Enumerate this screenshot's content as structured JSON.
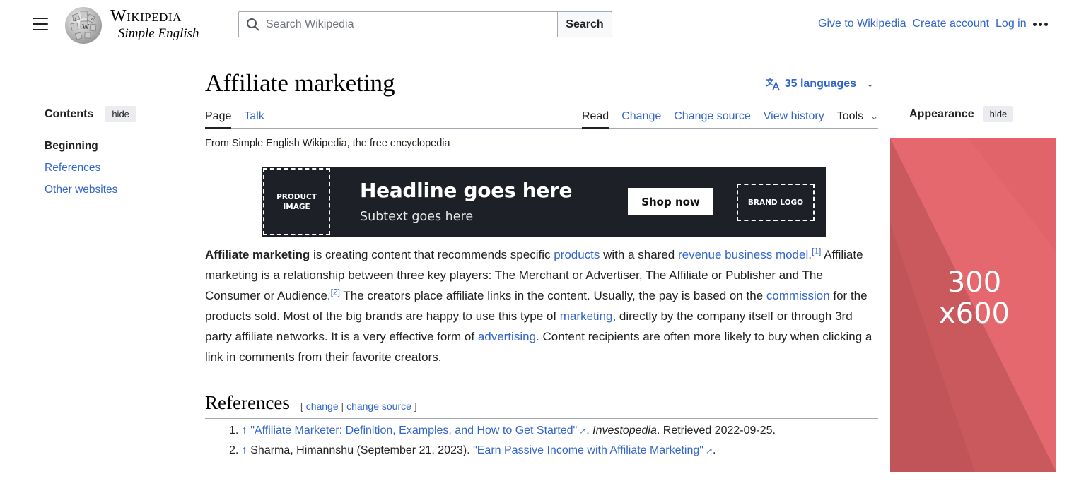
{
  "header": {
    "wordmark": "Wikipedia",
    "tagline": "Simple English",
    "search_placeholder": "Search Wikipedia",
    "search_button": "Search",
    "user_links": [
      "Give to Wikipedia",
      "Create account",
      "Log in"
    ]
  },
  "toc": {
    "title": "Contents",
    "hide": "hide",
    "items": [
      "Beginning",
      "References",
      "Other websites"
    ]
  },
  "article": {
    "title": "Affiliate marketing",
    "languages": "35 languages",
    "tabs_left": [
      "Page",
      "Talk"
    ],
    "tabs_right": [
      "Read",
      "Change",
      "Change source",
      "View history"
    ],
    "tools": "Tools",
    "from": "From Simple English Wikipedia, the free encyclopedia"
  },
  "banner": {
    "product_image": "PRODUCT IMAGE",
    "headline": "Headline goes here",
    "subtext": "Subtext goes here",
    "shop": "Shop now",
    "brand_logo": "BRAND LOGO"
  },
  "body": {
    "lead_bold": "Affiliate marketing",
    "t1": " is creating content that recommends specific ",
    "l1": "products",
    "t2": " with a shared ",
    "l2": "revenue business model",
    "t3": ".",
    "r1": "[1]",
    "t4": " Affiliate marketing is a relationship between three key players: The Merchant or Advertiser, The Affiliate or Publisher and The Consumer or Audience.",
    "r2": "[2]",
    "t5": " The creators place affiliate links in the content. Usually, the pay is based on the ",
    "l3": "commission",
    "t6": " for the products sold. Most of the big brands are happy to use this type of ",
    "l4": "marketing",
    "t7": ", directly by the company itself or through 3rd party affiliate networks. It is a very effective form of ",
    "l5": "advertising",
    "t8": ". Content recipients are often more likely to buy when clicking a link in comments from their favorite creators."
  },
  "references": {
    "title": "References",
    "edit_open": "[ ",
    "edit_change": "change",
    "edit_sep": " | ",
    "edit_source": "change source",
    "edit_close": " ]",
    "items": [
      {
        "num": "1.",
        "arrow": "↑",
        "pre": "",
        "link": "\"Affiliate Marketer: Definition, Examples, and How to Get Started\"",
        "post_italic": "Investopedia",
        "post": ". Retrieved 2022-09-25."
      },
      {
        "num": "2.",
        "arrow": "↑",
        "pre": "Sharma, Himannshu (September 21, 2023). ",
        "link": "\"Earn Passive Income with Affiliate Marketing\"",
        "post_italic": "",
        "post": "."
      }
    ]
  },
  "appearance": {
    "title": "Appearance",
    "hide": "hide"
  },
  "ad": {
    "text": "300\nx600",
    "color": "#e0646a"
  }
}
